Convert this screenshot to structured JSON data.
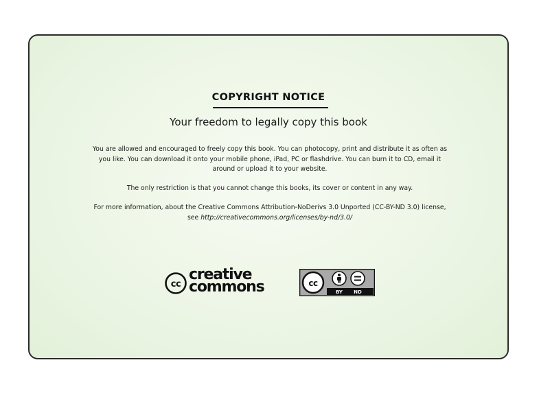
{
  "notice": {
    "title": "COPYRIGHT NOTICE",
    "subtitle": "Your freedom to legally copy this book",
    "paragraph1": "You are allowed and encouraged to freely copy this book. You can photocopy, print and distribute it as often as you like. You can download it onto your mobile phone, iPad, PC or flashdrive. You can burn it to CD, email it around or upload it to your website.",
    "paragraph2": "The only restriction is that you cannot change this books, its cover or content in any way.",
    "paragraph3_text": "For more information, about the Creative Commons Attribution-NoDerivs 3.0 Unported (CC-BY-ND 3.0) license, see ",
    "paragraph3_url": "http://creativecommons.org/licenses/by-nd/3.0/"
  },
  "logos": {
    "cc_mark": "cc",
    "cc_word1": "creative",
    "cc_word2": "commons",
    "badge_by": "BY",
    "badge_nd": "ND"
  }
}
